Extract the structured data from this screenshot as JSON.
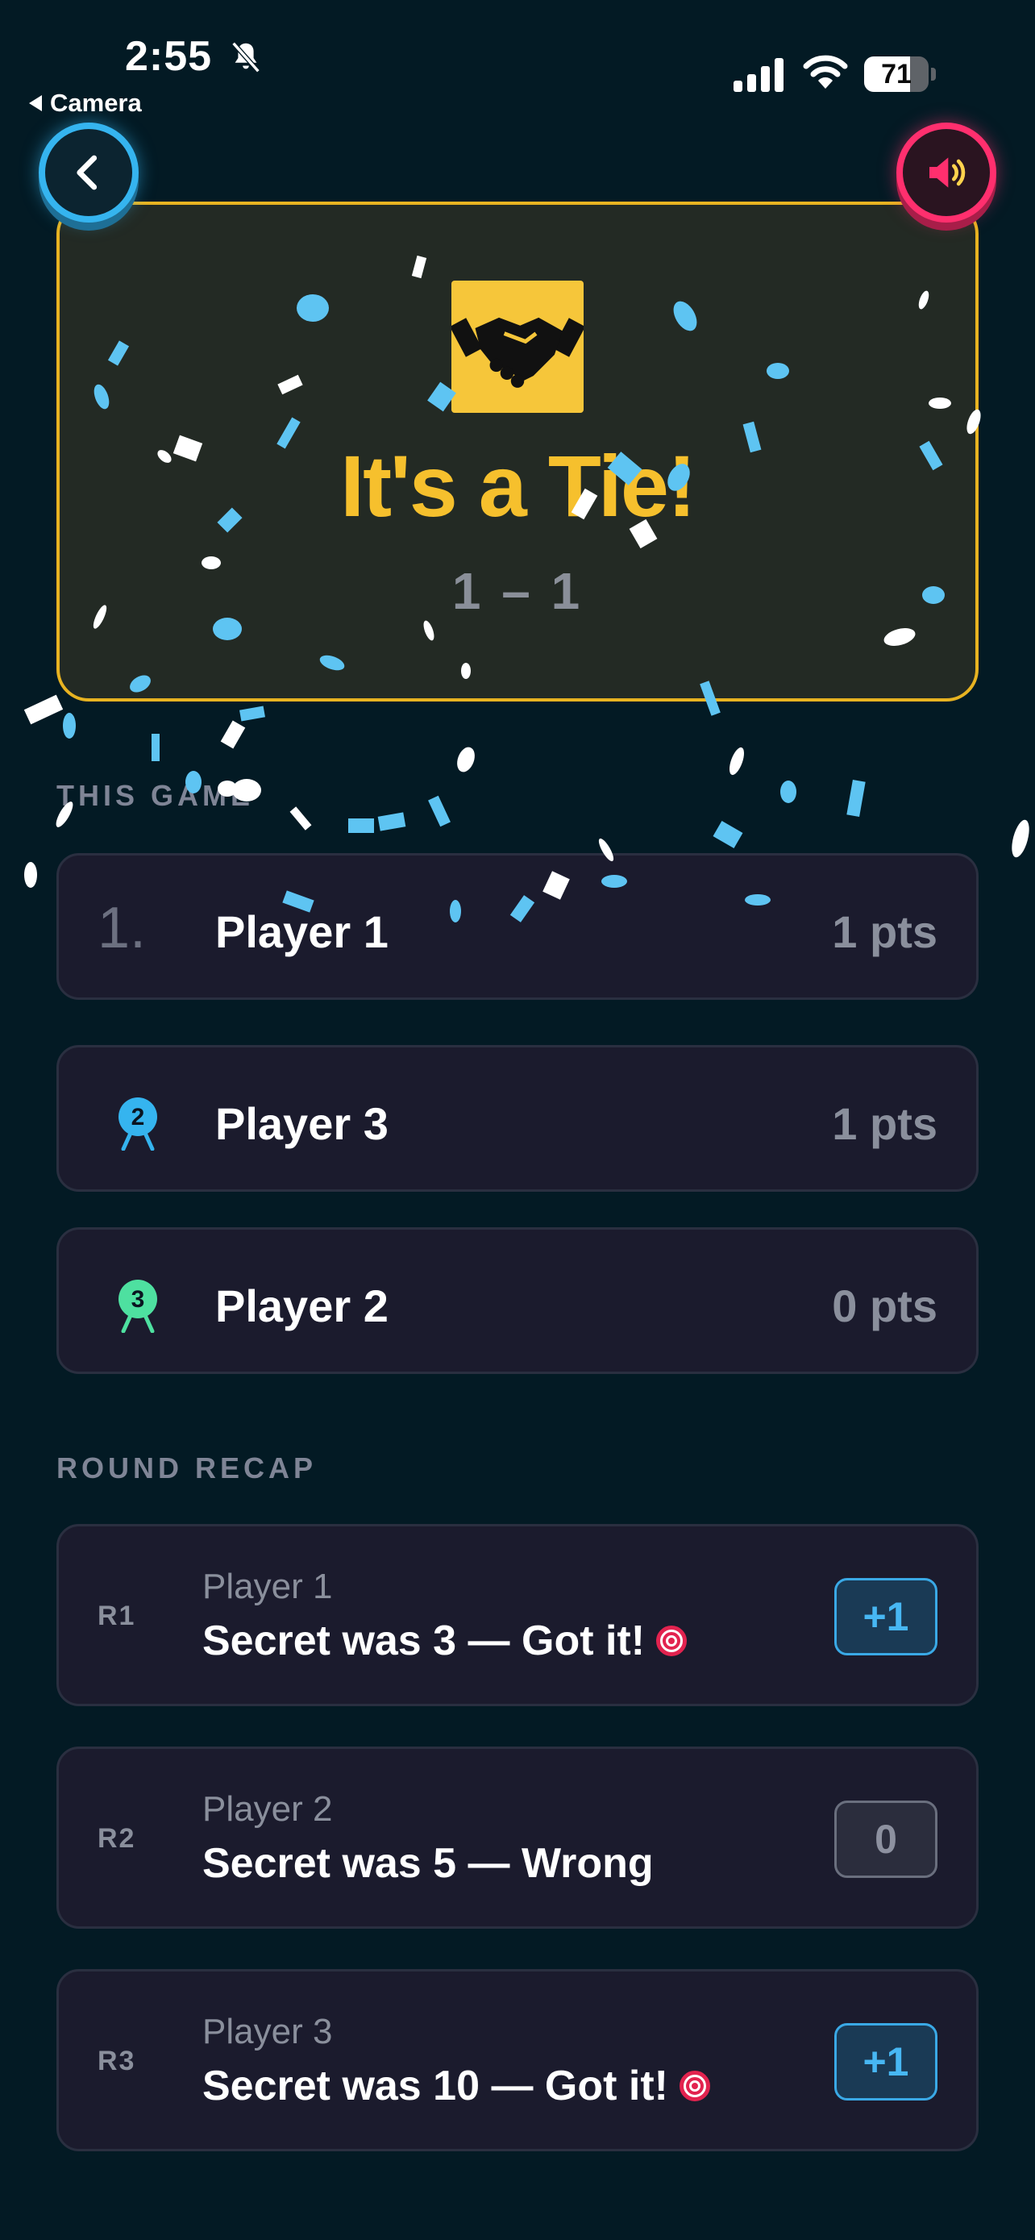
{
  "status_bar": {
    "time": "2:55",
    "back_app_label": "Camera",
    "battery_percent": "71",
    "battery_level": 0.71,
    "icons": [
      "bell-slash-icon",
      "signal-icon",
      "wifi-icon",
      "battery-icon"
    ]
  },
  "header": {
    "back_icon": "chevron-left-icon",
    "sound_icon": "speaker-icon"
  },
  "result": {
    "icon": "handshake-icon",
    "title": "It's a Tie!",
    "score": "1 – 1"
  },
  "leaderboard": {
    "label": "THIS GAME",
    "rows": [
      {
        "rank": "1.",
        "name": "Player 1",
        "points": "1 pts"
      },
      {
        "rank": "2",
        "name": "Player 3",
        "points": "1 pts",
        "medal_color": "#35b4ef"
      },
      {
        "rank": "3",
        "name": "Player 2",
        "points": "0 pts",
        "medal_color": "#4ee0a0"
      }
    ]
  },
  "recap": {
    "label": "ROUND RECAP",
    "rounds": [
      {
        "round": "R1",
        "player": "Player 1",
        "result": "Secret was 3 — Got it!",
        "target": true,
        "points": "+1"
      },
      {
        "round": "R2",
        "player": "Player 2",
        "result": "Secret was 5 — Wrong",
        "target": false,
        "points": "0"
      },
      {
        "round": "R3",
        "player": "Player 3",
        "result": "Secret was 10 — Got it!",
        "target": true,
        "points": "+1"
      }
    ]
  },
  "colors": {
    "background": "#031a24",
    "accent_yellow": "#f6c02d",
    "accent_blue": "#35b4ef",
    "accent_pink": "#ff2f6e",
    "card": "#1b1b2d"
  }
}
